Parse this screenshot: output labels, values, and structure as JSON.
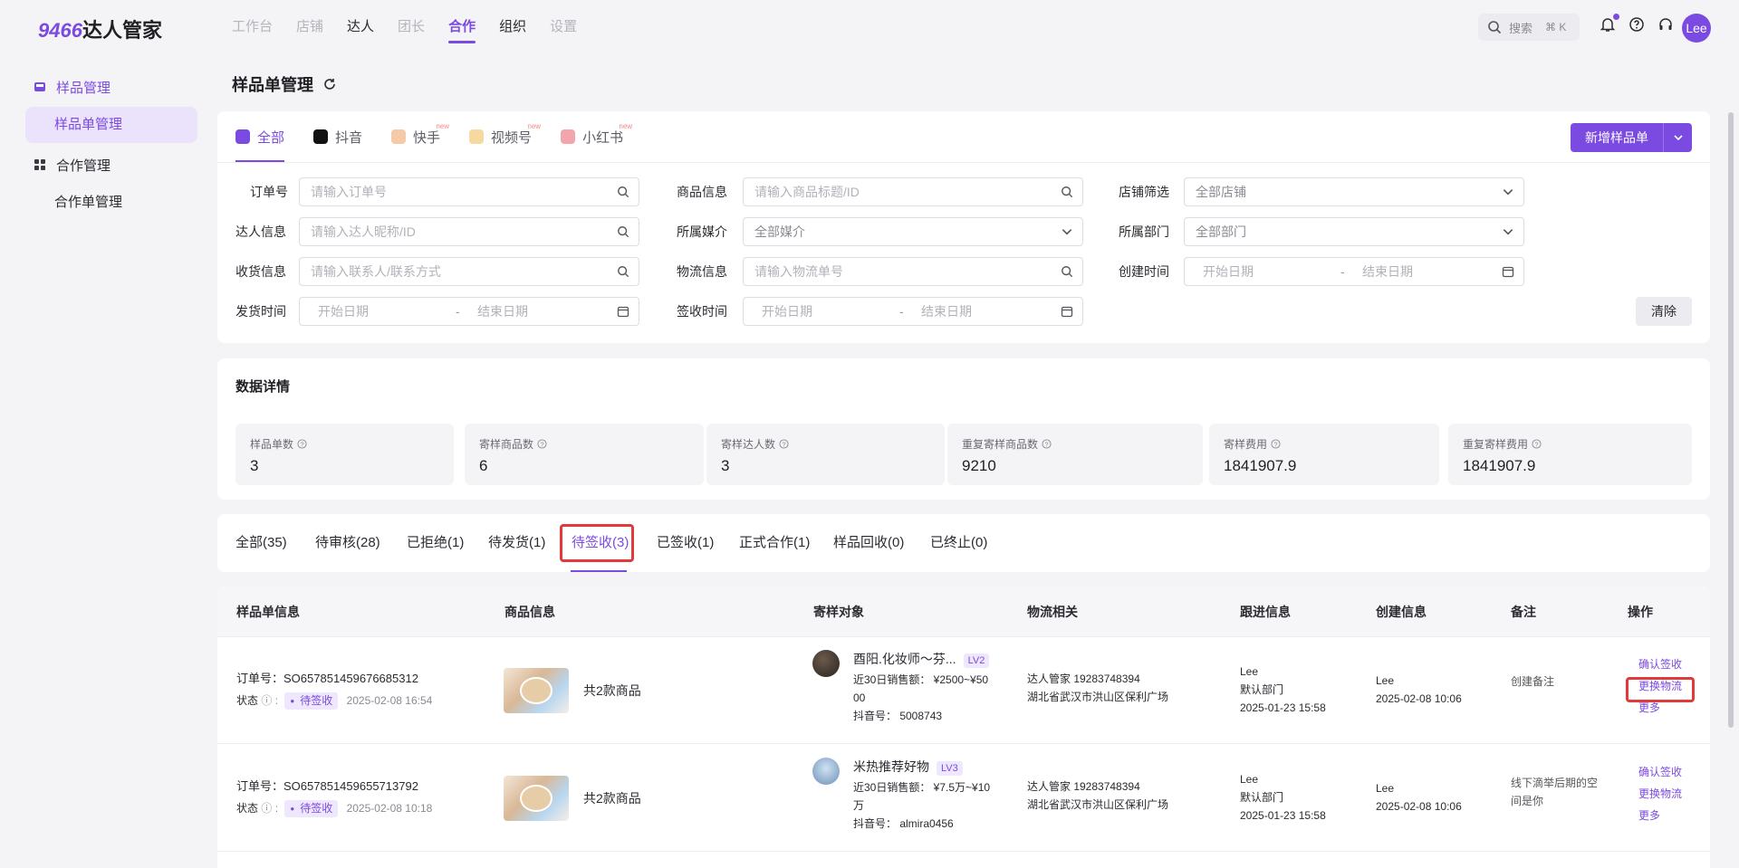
{
  "brand": {
    "num": "9466",
    "text": "达人管家"
  },
  "topnav": [
    {
      "label": "工作台",
      "state": "muted"
    },
    {
      "label": "店铺",
      "state": "muted"
    },
    {
      "label": "达人",
      "state": "dark"
    },
    {
      "label": "团长",
      "state": "muted"
    },
    {
      "label": "合作",
      "state": "active"
    },
    {
      "label": "组织",
      "state": "dark"
    },
    {
      "label": "设置",
      "state": "muted"
    }
  ],
  "search": {
    "label": "搜索",
    "shortcut": "⌘ K"
  },
  "user": {
    "initials": "Lee"
  },
  "sidebar": {
    "group1": "样品管理",
    "item1": "样品单管理",
    "group2": "合作管理",
    "item2": "合作单管理"
  },
  "page": {
    "title": "样品单管理"
  },
  "platform_tabs": [
    {
      "label": "全部",
      "active": true
    },
    {
      "label": "抖音"
    },
    {
      "label": "快手",
      "badge": "new"
    },
    {
      "label": "视频号",
      "badge": "new"
    },
    {
      "label": "小红书",
      "badge": "new"
    }
  ],
  "new_button": "新增样品单",
  "filters": {
    "order_no": {
      "label": "订单号",
      "placeholder": "请输入订单号"
    },
    "product": {
      "label": "商品信息",
      "placeholder": "请输入商品标题/ID"
    },
    "shop": {
      "label": "店铺筛选",
      "value": "全部店铺"
    },
    "talent": {
      "label": "达人信息",
      "placeholder": "请输入达人昵称/ID"
    },
    "media": {
      "label": "所属媒介",
      "value": "全部媒介"
    },
    "dept": {
      "label": "所属部门",
      "value": "全部部门"
    },
    "receiver": {
      "label": "收货信息",
      "placeholder": "请输入联系人/联系方式"
    },
    "logistics": {
      "label": "物流信息",
      "placeholder": "请输入物流单号"
    },
    "created": {
      "label": "创建时间",
      "start": "开始日期",
      "end": "结束日期"
    },
    "shipped": {
      "label": "发货时间",
      "start": "开始日期",
      "end": "结束日期"
    },
    "signed": {
      "label": "签收时间",
      "start": "开始日期",
      "end": "结束日期"
    },
    "dash": "-",
    "clear": "清除"
  },
  "stats": {
    "title": "数据详情",
    "items": [
      {
        "label": "样品单数",
        "value": "3"
      },
      {
        "label": "寄样商品数",
        "value": "6"
      },
      {
        "label": "寄样达人数",
        "value": "3"
      },
      {
        "label": "重复寄样商品数",
        "value": "9210"
      },
      {
        "label": "寄样费用",
        "value": "1841907.9"
      },
      {
        "label": "重复寄样费用",
        "value": "1841907.9"
      }
    ]
  },
  "status_tabs": [
    "全部(35)",
    "待审核(28)",
    "已拒绝(1)",
    "待发货(1)",
    "待签收(3)",
    "已签收(1)",
    "正式合作(1)",
    "样品回收(0)",
    "已终止(0)"
  ],
  "table": {
    "headers": [
      "样品单信息",
      "商品信息",
      "寄样对象",
      "物流相关",
      "跟进信息",
      "创建信息",
      "备注",
      "操作"
    ],
    "rows": [
      {
        "order_label": "订单号：",
        "order_no": "SO657851459676685312",
        "status_label": "状态",
        "status": "待签收",
        "status_time": "2025-02-08 16:54",
        "product": "共2款商品",
        "talent_name": "酉阳.化妆师～芬...",
        "talent_level": "LV2",
        "sales_line1": "近30日销售额：  ¥2500~¥50",
        "sales_line2": "00",
        "douyin": "抖音号：  5008743",
        "logistics_name": "达人管家  19283748394",
        "logistics_addr": "湖北省武汉市洪山区保利广场",
        "follow_user": "Lee",
        "follow_dept": "默认部门",
        "follow_time": "2025-01-23 15:58",
        "creator": "Lee",
        "create_time": "2025-02-08 10:06",
        "note": "创建备注",
        "note2": "",
        "ops": [
          "确认签收",
          "更换物流",
          "更多"
        ]
      },
      {
        "order_label": "订单号：",
        "order_no": "SO657851459655713792",
        "status_label": "状态",
        "status": "待签收",
        "status_time": "2025-02-08 10:18",
        "product": "共2款商品",
        "talent_name": "米热推荐好物",
        "talent_level": "LV3",
        "sales_line1": "近30日销售额：  ¥7.5万~¥10",
        "sales_line2": "万",
        "douyin": "抖音号：  almira0456",
        "logistics_name": "达人管家  19283748394",
        "logistics_addr": "湖北省武汉市洪山区保利广场",
        "follow_user": "Lee",
        "follow_dept": "默认部门",
        "follow_time": "2025-01-23 15:58",
        "creator": "Lee",
        "create_time": "2025-02-08 10:06",
        "note": "线下滴举后期的空",
        "note2": "间是你",
        "ops": [
          "确认签收",
          "更换物流",
          "更多"
        ]
      }
    ]
  },
  "colors": {
    "accent": "#7b4ae0",
    "highlight": "#e03a3a"
  }
}
